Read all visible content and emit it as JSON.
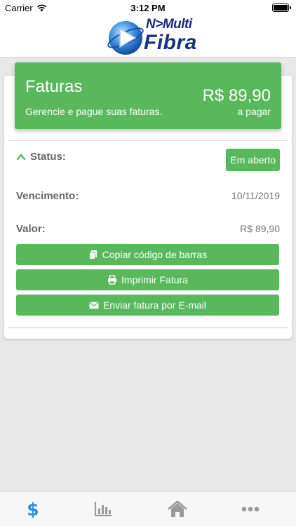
{
  "status_bar": {
    "carrier": "Carrier",
    "time": "3:12 PM",
    "icons": [
      "wifi-icon",
      "battery-icon"
    ]
  },
  "header": {
    "logo_top": "N>Multi",
    "logo_bottom": "Fibra",
    "logo_icon": "play-globe-logo"
  },
  "banner": {
    "title": "Faturas",
    "subtitle": "Gerencie e pague suas faturas.",
    "amount": "R$ 89,90",
    "amount_caption": "a pagar"
  },
  "details": {
    "status_label": "Status:",
    "status_value": "Em aberto",
    "due_label": "Vencimento:",
    "due_value": "10/11/2019",
    "value_label": "Valor:",
    "value_value": "R$ 89,90"
  },
  "actions": {
    "copy_barcode": "Copiar código de barras",
    "print": "Imprimir Fatura",
    "email": "Enviar fatura por E-mail"
  },
  "tabbar": {
    "tabs": [
      {
        "icon": "dollar-icon",
        "active": true
      },
      {
        "icon": "bar-chart-icon",
        "active": false
      },
      {
        "icon": "home-icon",
        "active": false
      },
      {
        "icon": "more-icon",
        "active": false
      }
    ]
  },
  "colors": {
    "accent": "#59b75c",
    "active_tab": "#2f8fdd",
    "inactive_tab": "#9a9a9a"
  }
}
